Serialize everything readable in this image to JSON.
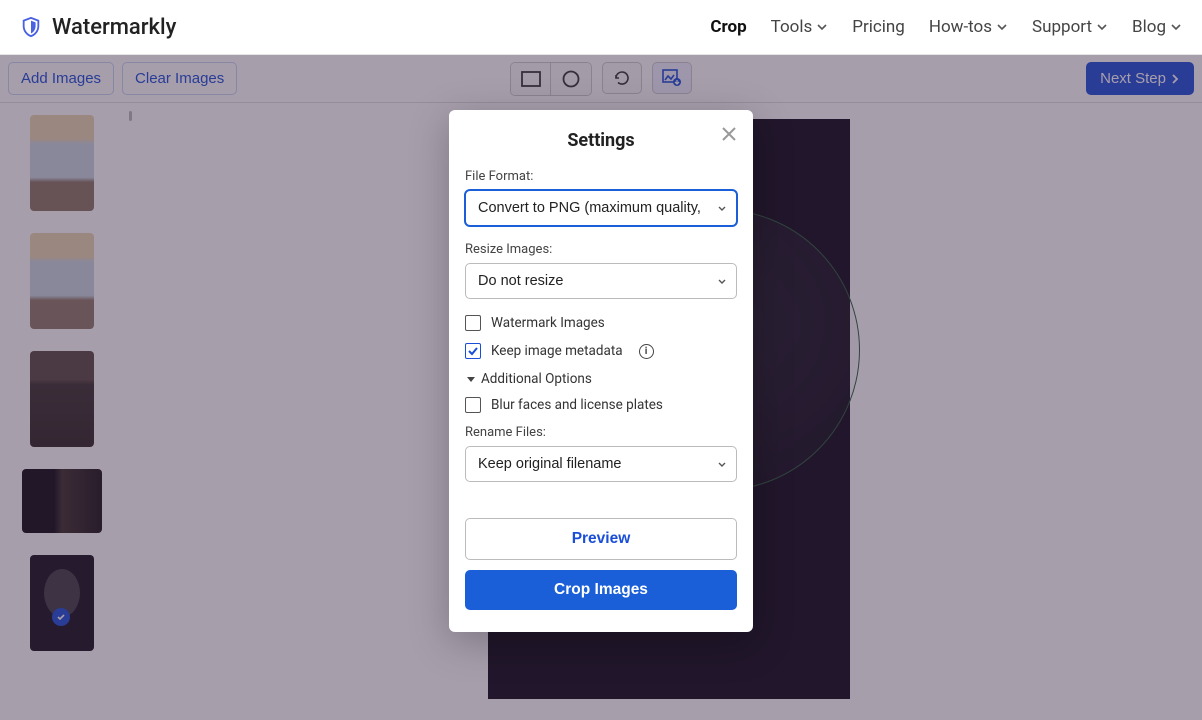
{
  "brand": "Watermarkly",
  "nav": {
    "crop": "Crop",
    "tools": "Tools",
    "pricing": "Pricing",
    "howtos": "How-tos",
    "support": "Support",
    "blog": "Blog"
  },
  "toolbar": {
    "add_images": "Add Images",
    "clear_images": "Clear Images",
    "next_step": "Next Step"
  },
  "modal": {
    "title": "Settings",
    "file_format_label": "File Format:",
    "file_format_value": "Convert to PNG (maximum quality,",
    "resize_label": "Resize Images:",
    "resize_value": "Do not resize",
    "watermark_label": "Watermark Images",
    "watermark_checked": false,
    "metadata_label": "Keep image metadata",
    "metadata_checked": true,
    "additional_label": "Additional Options",
    "blur_label": "Blur faces and license plates",
    "blur_checked": false,
    "rename_label": "Rename Files:",
    "rename_value": "Keep original filename",
    "preview_btn": "Preview",
    "crop_btn": "Crop Images"
  }
}
